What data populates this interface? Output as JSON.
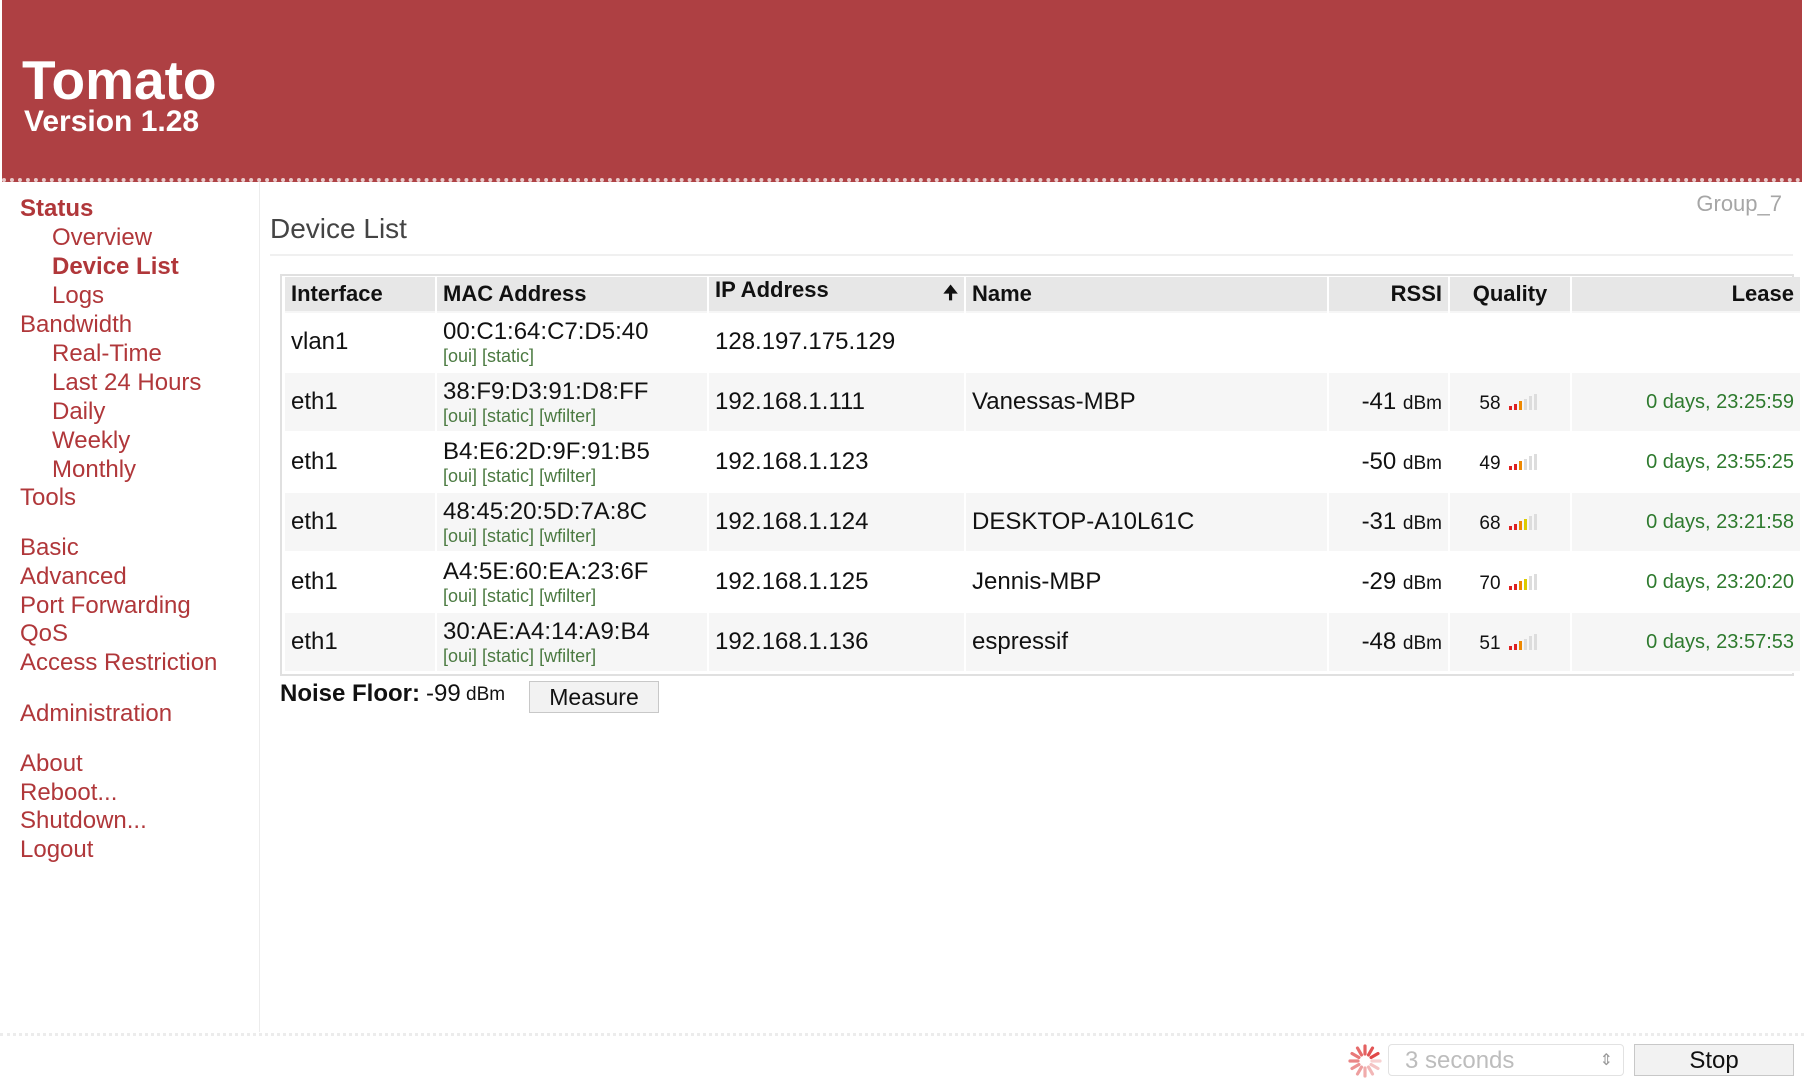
{
  "header": {
    "title": "Tomato",
    "version": "Version 1.28"
  },
  "group_name": "Group_7",
  "page_title": "Device List",
  "sidebar": {
    "status": "Status",
    "status_items": [
      "Overview",
      "Device List",
      "Logs"
    ],
    "bandwidth": "Bandwidth",
    "bandwidth_items": [
      "Real-Time",
      "Last 24 Hours",
      "Daily",
      "Weekly",
      "Monthly"
    ],
    "tools": "Tools",
    "config_items": [
      "Basic",
      "Advanced",
      "Port Forwarding",
      "QoS",
      "Access Restriction"
    ],
    "administration": "Administration",
    "system_items": [
      "About",
      "Reboot...",
      "Shutdown...",
      "Logout"
    ]
  },
  "table": {
    "headers": {
      "interface": "Interface",
      "mac": "MAC Address",
      "ip": "IP Address",
      "name": "Name",
      "rssi": "RSSI",
      "quality": "Quality",
      "lease": "Lease"
    },
    "sort_icon": "sort-up-arrow-icon",
    "rssi_unit": "dBm",
    "rows": [
      {
        "interface": "vlan1",
        "mac": "00:C1:64:C7:D5:40",
        "links": [
          "[oui]",
          "[static]"
        ],
        "ip": "128.197.175.129",
        "name": "",
        "rssi": "",
        "quality": "",
        "quality_level": 0,
        "lease": ""
      },
      {
        "interface": "eth1",
        "mac": "38:F9:D3:91:D8:FF",
        "links": [
          "[oui]",
          "[static]",
          "[wfilter]"
        ],
        "ip": "192.168.1.111",
        "name": "Vanessas-MBP",
        "rssi": "-41",
        "quality": "58",
        "quality_level": 0.58,
        "lease": "0 days, 23:25:59"
      },
      {
        "interface": "eth1",
        "mac": "B4:E6:2D:9F:91:B5",
        "links": [
          "[oui]",
          "[static]",
          "[wfilter]"
        ],
        "ip": "192.168.1.123",
        "name": "",
        "rssi": "-50",
        "quality": "49",
        "quality_level": 0.49,
        "lease": "0 days, 23:55:25"
      },
      {
        "interface": "eth1",
        "mac": "48:45:20:5D:7A:8C",
        "links": [
          "[oui]",
          "[static]",
          "[wfilter]"
        ],
        "ip": "192.168.1.124",
        "name": "DESKTOP-A10L61C",
        "rssi": "-31",
        "quality": "68",
        "quality_level": 0.68,
        "lease": "0 days, 23:21:58"
      },
      {
        "interface": "eth1",
        "mac": "A4:5E:60:EA:23:6F",
        "links": [
          "[oui]",
          "[static]",
          "[wfilter]"
        ],
        "ip": "192.168.1.125",
        "name": "Jennis-MBP",
        "rssi": "-29",
        "quality": "70",
        "quality_level": 0.7,
        "lease": "0 days, 23:20:20"
      },
      {
        "interface": "eth1",
        "mac": "30:AE:A4:14:A9:B4",
        "links": [
          "[oui]",
          "[static]",
          "[wfilter]"
        ],
        "ip": "192.168.1.136",
        "name": "espressif",
        "rssi": "-48",
        "quality": "51",
        "quality_level": 0.51,
        "lease": "0 days, 23:57:53"
      }
    ]
  },
  "noise_floor": {
    "label": "Noise Floor:",
    "value": "-99",
    "unit": "dBm",
    "measure_label": "Measure"
  },
  "footer": {
    "refresh_value": "3 seconds",
    "stop_label": "Stop",
    "spinner_icon": "loading-spinner-icon",
    "chevron_icon": "select-chevron-icon"
  },
  "colors": {
    "header_bg": "#ae4043",
    "link": "#b0373a",
    "lease_green": "#2e7a2e",
    "link_green": "#4b7a41",
    "bar_red": "#dd2222",
    "bar_orange": "#ee8800",
    "bar_yellow": "#ddcc00",
    "bar_green": "#33aa33",
    "bar_empty": "#dddddd"
  }
}
